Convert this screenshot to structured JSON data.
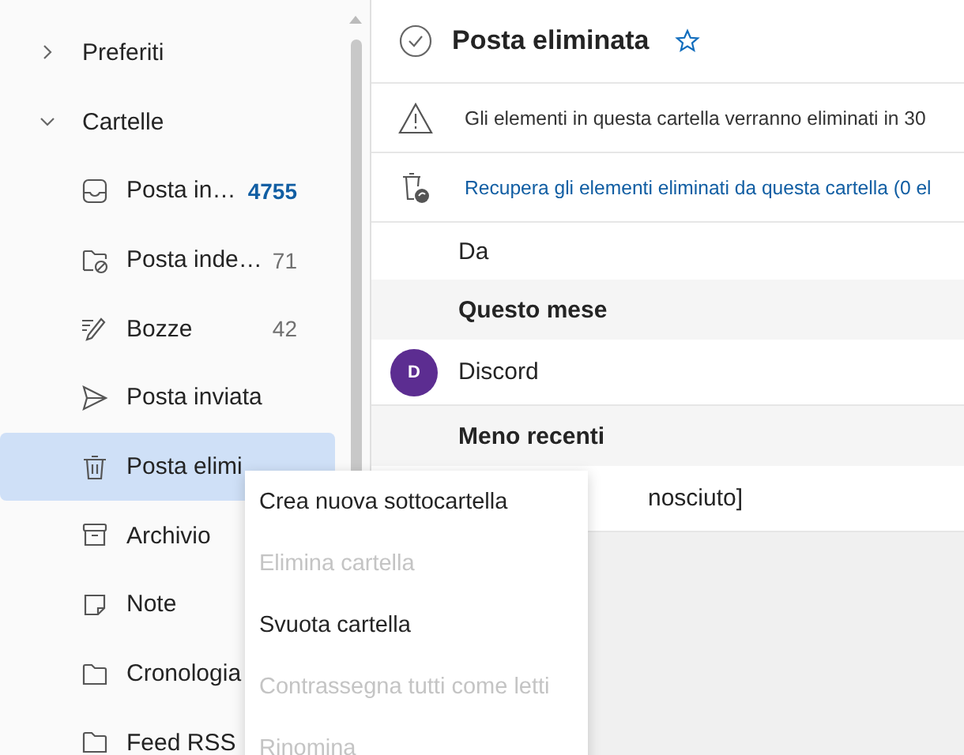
{
  "sidebar": {
    "sections": [
      {
        "label": "Preferiti",
        "expanded": false
      },
      {
        "label": "Cartelle",
        "expanded": true,
        "folders": [
          {
            "kind": "inbox",
            "label": "Posta in…",
            "count": "4755",
            "unread": true,
            "selected": false
          },
          {
            "kind": "blocked-folder",
            "label": "Posta inde…",
            "count": "71",
            "unread": false,
            "selected": false
          },
          {
            "kind": "draft",
            "label": "Bozze",
            "count": "42",
            "unread": false,
            "selected": false
          },
          {
            "kind": "send",
            "label": "Posta inviata",
            "selected": false
          },
          {
            "kind": "trash",
            "label": "Posta elimi",
            "selected": true
          },
          {
            "kind": "archive",
            "label": "Archivio",
            "selected": false
          },
          {
            "kind": "note",
            "label": "Note",
            "selected": false
          },
          {
            "kind": "folder",
            "label": "Cronologia",
            "selected": false
          },
          {
            "kind": "folder",
            "label": "Feed RSS",
            "selected": false
          }
        ]
      }
    ]
  },
  "message_list": {
    "title": "Posta eliminata",
    "starred": false,
    "notices": [
      {
        "kind": "warning",
        "text": "Gli elementi in questa cartella verranno eliminati in 30"
      },
      {
        "kind": "recover",
        "text": "Recupera gli elementi eliminati da questa cartella (0 el"
      }
    ],
    "column_header": "Da",
    "groups": [
      {
        "label": "Questo mese",
        "messages": [
          {
            "sender": "Discord",
            "avatar": "D",
            "color": "#5c2d91"
          }
        ]
      },
      {
        "label": "Meno recenti",
        "messages": [
          {
            "sender": "nosciuto]"
          }
        ]
      }
    ]
  },
  "context_menu": {
    "items": [
      {
        "label": "Crea nuova sottocartella",
        "disabled": false
      },
      {
        "label": "Elimina cartella",
        "disabled": true
      },
      {
        "label": "Svuota cartella",
        "disabled": false
      },
      {
        "label": "Contrassegna tutti come letti",
        "disabled": true
      },
      {
        "label": "Rinomina",
        "disabled": true
      }
    ]
  }
}
